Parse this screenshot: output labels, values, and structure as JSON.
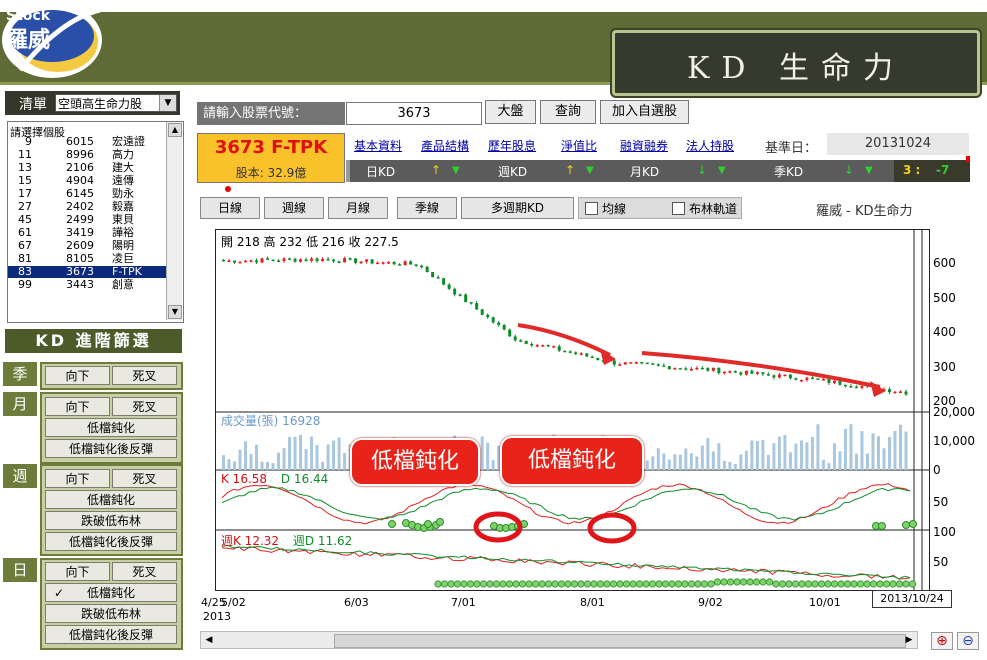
{
  "app": {
    "logo_top": "Stock",
    "logo_main": "羅威",
    "banner_title": "KD 生命力"
  },
  "left_panel": {
    "list_label": "清單",
    "list_select": "空頭高生命力股",
    "list_heading": "請選擇個股",
    "stocks": [
      {
        "no": "9",
        "code": "6015",
        "name": "宏遠證"
      },
      {
        "no": "11",
        "code": "8996",
        "name": "高力"
      },
      {
        "no": "13",
        "code": "2106",
        "name": "建大"
      },
      {
        "no": "15",
        "code": "4904",
        "name": "遠傳"
      },
      {
        "no": "17",
        "code": "6145",
        "name": "勁永"
      },
      {
        "no": "27",
        "code": "2402",
        "name": "毅嘉"
      },
      {
        "no": "45",
        "code": "2499",
        "name": "東貝"
      },
      {
        "no": "61",
        "code": "3419",
        "name": "譁裕"
      },
      {
        "no": "67",
        "code": "2609",
        "name": "陽明"
      },
      {
        "no": "81",
        "code": "8105",
        "name": "凌巨"
      },
      {
        "no": "83",
        "code": "3673",
        "name": "F-TPK"
      },
      {
        "no": "99",
        "code": "3443",
        "name": "創意"
      }
    ],
    "kd_filter_title": "KD 進階篩選",
    "groups": {
      "season": {
        "label": "季",
        "buttons": [
          "向下",
          "死叉"
        ]
      },
      "month": {
        "label": "月",
        "buttons": [
          "向下",
          "死叉",
          "低檔鈍化",
          "低檔鈍化後反彈"
        ]
      },
      "week": {
        "label": "週",
        "buttons": [
          "向下",
          "死叉",
          "低檔鈍化",
          "跌破低布林",
          "低檔鈍化後反彈"
        ]
      },
      "day": {
        "label": "日",
        "buttons": [
          "向下",
          "死叉",
          "低檔鈍化",
          "跌破低布林",
          "低檔鈍化後反彈"
        ],
        "checked_mark": "✓"
      }
    }
  },
  "top": {
    "input_label": "請輸入股票代號：",
    "input_value": "3673",
    "btn_market": "大盤",
    "btn_query": "查詢",
    "btn_add": "加入自選股",
    "stock_title": "3673 F-TPK",
    "capital": "股本: 32.9億",
    "links": [
      "基本資料",
      "產品結構",
      "歷年股息",
      "淨值比",
      "融資融券",
      "法人持股"
    ],
    "base_date_label": "基準日：",
    "base_date": "20131024",
    "kd_day": "日KD",
    "kd_week": "週KD",
    "kd_month": "月KD",
    "kd_season": "季KD",
    "score": "3 :",
    "score_neg": "-7",
    "up_arrow": "↑",
    "down_tri": "▼",
    "down_arrow": "↓"
  },
  "tabs": {
    "day": "日線",
    "week": "週線",
    "month": "月線",
    "season": "季線",
    "multi": "多週期KD",
    "ma": "均線",
    "boll": "布林軌道",
    "chart_title": "羅威 - KD生命力"
  },
  "chart": {
    "ohlc_text": "開 218 高 232 低 216 收 227.5",
    "price_ticks": [
      "600",
      "500",
      "400",
      "300",
      "200"
    ],
    "volume_label": "成交量(張) 16928",
    "volume_ticks": [
      "20,000",
      "10,000",
      "0"
    ],
    "kd_day_k": "K 16.58",
    "kd_day_d": "D 16.44",
    "kd_week_k": "週K 12.32",
    "kd_week_d": "週D 11.62",
    "kd_ticks_a": [
      "0",
      "50",
      "100"
    ],
    "kd_ticks_b": [
      "50"
    ],
    "x_labels": [
      "4/25",
      "5/02",
      "6/03",
      "7/01",
      "8/01",
      "9/02",
      "10/01"
    ],
    "x_year": "2013",
    "cursor_date": "2013/10/24",
    "callout_1": "低檔鈍化",
    "callout_2": "低檔鈍化",
    "colors": {
      "up": "#e02020",
      "down": "#0f8c2a",
      "k_line": "#e02020",
      "d_line": "#0f8c2a",
      "volume": "#aac7e0",
      "arrow": "#e12b28"
    }
  },
  "chart_data": {
    "type": "line",
    "x": [
      "4/25",
      "5/02",
      "6/03",
      "7/01",
      "8/01",
      "9/02",
      "10/01",
      "10/24"
    ],
    "series": [
      {
        "values": [
          595,
          600,
          585,
          375,
          310,
          290,
          265,
          227.5
        ]
      }
    ],
    "ylim": [
      200,
      620
    ]
  },
  "zoom": {
    "in": "⊕",
    "out": "⊖"
  }
}
